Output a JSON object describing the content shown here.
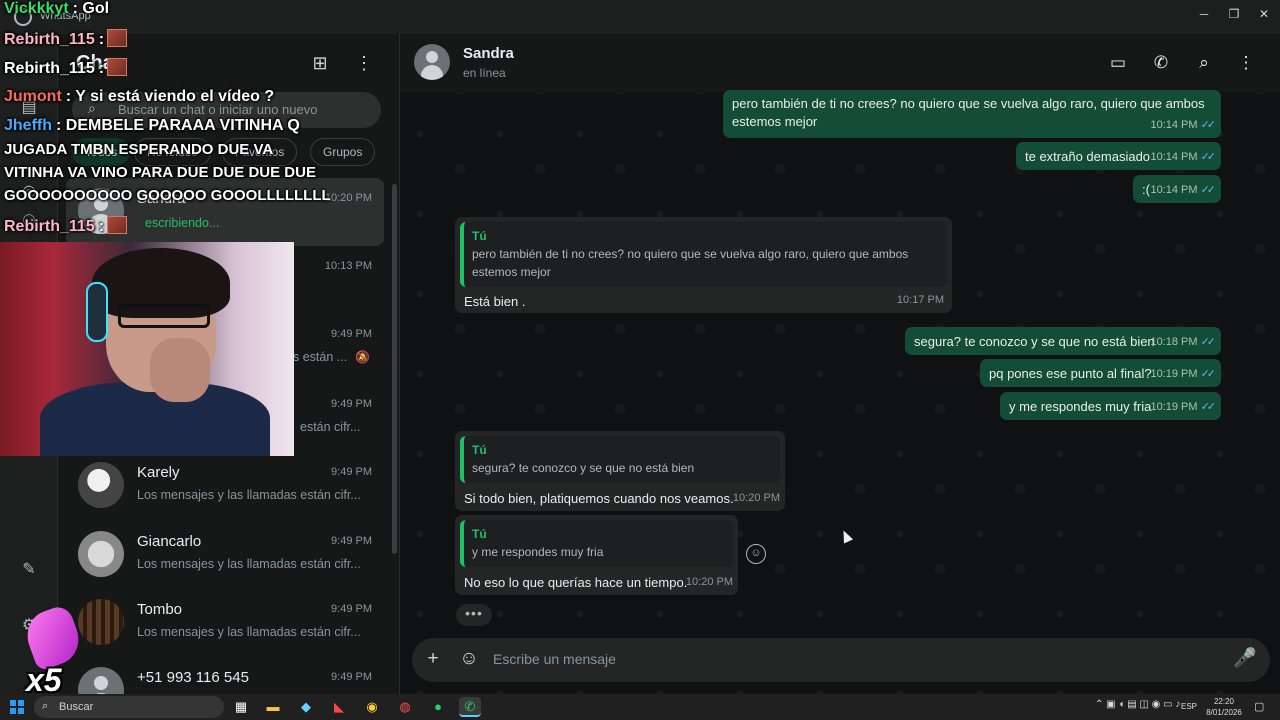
{
  "window": {
    "app_title": "WhatsApp",
    "minimize": "─",
    "maximize": "❐",
    "close": "✕"
  },
  "chat_list": {
    "title": "Cha",
    "search_placeholder": "Buscar un chat o iniciar uno nuevo",
    "filters": [
      "Todos",
      "No leídos",
      "Favoritos",
      "Grupos"
    ],
    "chats": [
      {
        "name": "Sandra",
        "time": "10:20 PM",
        "preview": "escribiendo...",
        "typing": true,
        "selected": true
      },
      {
        "name": "",
        "time": "10:13 PM",
        "preview": ""
      },
      {
        "name": "",
        "time": "9:49 PM",
        "preview": "s están ...",
        "muted": true
      },
      {
        "name": "",
        "time": "9:49 PM",
        "preview": "están cifr..."
      },
      {
        "name": "Karely",
        "time": "9:49 PM",
        "preview": "Los mensajes y las llamadas están cifr..."
      },
      {
        "name": "Giancarlo",
        "time": "9:49 PM",
        "preview": "Los mensajes y las llamadas están cifr..."
      },
      {
        "name": "Tombo",
        "time": "9:49 PM",
        "preview": "Los mensajes y las llamadas están cifr..."
      },
      {
        "name": "+51 993 116 545",
        "time": "9:49 PM",
        "preview": ""
      }
    ]
  },
  "conversation": {
    "contact_name": "Sandra",
    "contact_status": "en línea",
    "composer_placeholder": "Escribe un mensaje",
    "messages": [
      {
        "dir": "out",
        "text1": "pero también de ti no crees? no quiero que se vuelva algo raro, quiero que ambos",
        "text2": "estemos mejor",
        "time": "10:14 PM"
      },
      {
        "dir": "out",
        "text": "te extraño demasiado",
        "time": "10:14 PM"
      },
      {
        "dir": "out",
        "text": ":(",
        "time": "10:14 PM"
      },
      {
        "dir": "in",
        "quote_author": "Tú",
        "quote1": "pero también de ti no crees? no quiero que se vuelva algo raro, quiero que ambos",
        "quote2": "estemos mejor",
        "text": "Está bien .",
        "time": "10:17 PM"
      },
      {
        "dir": "out",
        "text": "segura? te conozco y se que no está bien",
        "time": "10:18 PM"
      },
      {
        "dir": "out",
        "text": "pq pones ese punto al final?",
        "time": "10:19 PM"
      },
      {
        "dir": "out",
        "text": "y me respondes muy fria",
        "time": "10:19 PM"
      },
      {
        "dir": "in",
        "quote_author": "Tú",
        "quote1": "segura? te conozco y se que no está bien",
        "text": "Si todo bien, platiquemos cuando nos veamos.",
        "time": "10:20 PM"
      },
      {
        "dir": "in",
        "quote_author": "Tú",
        "quote1": "y me respondes muy fria",
        "text": "No eso lo que querías hace un tiempo.",
        "time": "10:20 PM"
      }
    ]
  },
  "overlay": {
    "lines": [
      {
        "user": "Vickkkyt",
        "user_color": "#35e06a",
        "text": ": Gol"
      },
      {
        "user": "Rebirth_115",
        "user_color": "#ffb3c8",
        "text": ":",
        "emote": true
      },
      {
        "user": "Rebirth_115",
        "user_color": "#ffffff",
        "text": ":",
        "emote": true
      },
      {
        "user": "Jumont",
        "user_color": "#ff6a5a",
        "text": ": Y si está viendo el vídeo ?"
      },
      {
        "user": "Jheffh",
        "user_color": "#4aa8ff",
        "text": ": DEMBELE PARAAA VITINHA Q"
      },
      {
        "user": "",
        "user_color": "#ffffff",
        "text": "JUGADA TMBN ESPERANDO DUE VA"
      },
      {
        "user": "",
        "user_color": "#ffffff",
        "text": "VITINHA VA VINO PARA DUE DUE DUE DUE"
      },
      {
        "user": "",
        "user_color": "#ffffff",
        "text": "GOOOOOOOOOO GOOOOO GOOOLLLLLLLL"
      },
      {
        "user": "Rebirth_115",
        "user_color": "#ffb3c8",
        "text": ":",
        "emote": true
      }
    ],
    "badge_text": "x5"
  },
  "taskbar": {
    "search_label": "Buscar",
    "lang": "ESP",
    "time": "22:20",
    "date": "8/01/2026"
  },
  "colors": {
    "accent_green": "#21c063",
    "outgoing_bubble": "#144d37",
    "incoming_bubble": "#242626",
    "read_ticks": "#53bdeb"
  }
}
